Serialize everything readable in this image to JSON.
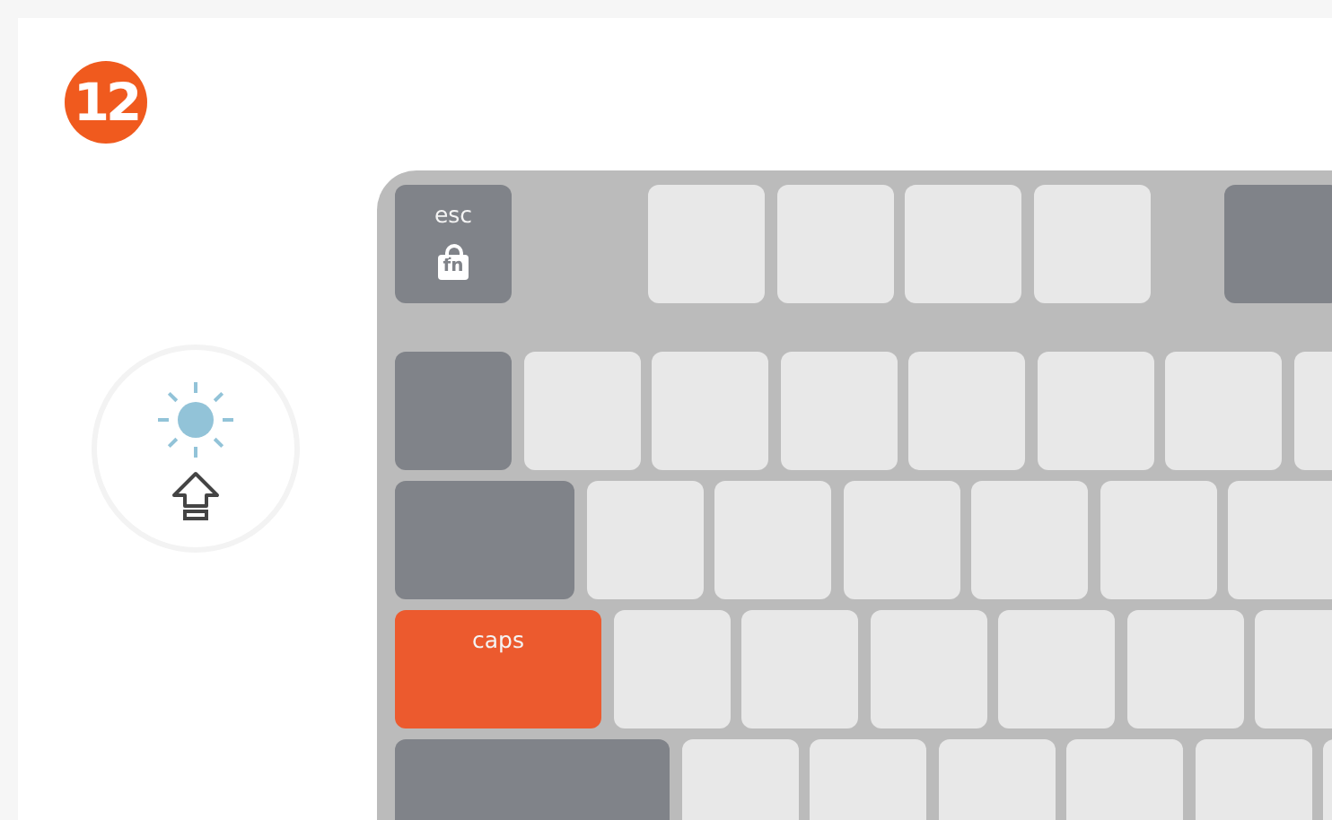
{
  "badge": "12",
  "indicator": {
    "kind": "backlight-shift"
  },
  "keyboard": {
    "rows": [
      [
        {
          "kind": "modifier",
          "label": "esc",
          "sublabel": "fn"
        },
        {
          "kind": "key"
        },
        {
          "kind": "key"
        },
        {
          "kind": "key"
        },
        {
          "kind": "key"
        },
        {
          "kind": "modifier"
        }
      ],
      [
        {
          "kind": "modifier"
        },
        {
          "kind": "key"
        },
        {
          "kind": "key"
        },
        {
          "kind": "key"
        },
        {
          "kind": "key"
        },
        {
          "kind": "key"
        },
        {
          "kind": "key"
        },
        {
          "kind": "key"
        }
      ],
      [
        {
          "kind": "modifier"
        },
        {
          "kind": "key"
        },
        {
          "kind": "key"
        },
        {
          "kind": "key"
        },
        {
          "kind": "key"
        },
        {
          "kind": "key"
        },
        {
          "kind": "key"
        }
      ],
      [
        {
          "kind": "highlighted",
          "label": "caps"
        },
        {
          "kind": "key"
        },
        {
          "kind": "key"
        },
        {
          "kind": "key"
        },
        {
          "kind": "key"
        },
        {
          "kind": "key"
        },
        {
          "kind": "key"
        }
      ],
      [
        {
          "kind": "modifier"
        },
        {
          "kind": "key"
        },
        {
          "kind": "key"
        },
        {
          "kind": "key"
        },
        {
          "kind": "key"
        },
        {
          "kind": "key"
        },
        {
          "kind": "key"
        }
      ]
    ]
  }
}
